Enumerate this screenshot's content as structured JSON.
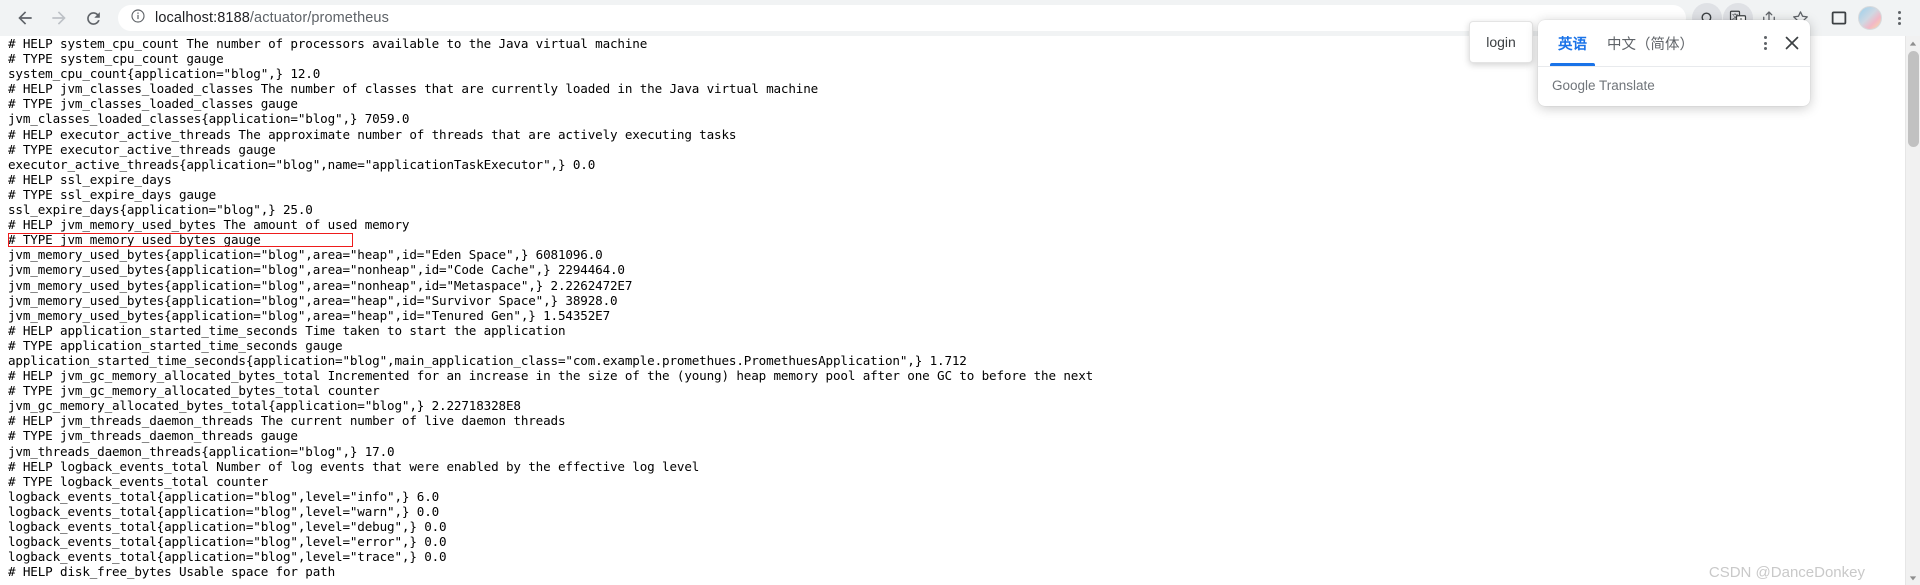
{
  "browser": {
    "back_label": "Back",
    "forward_label": "Forward",
    "reload_label": "Reload",
    "url_host": "localhost:8188",
    "url_path": "/actuator/prometheus",
    "url_full": "localhost:8188/actuator/prometheus",
    "icons": {
      "info": "info-icon",
      "search": "search-icon",
      "translate": "translate-icon",
      "share": "share-icon",
      "bookmark": "star-icon",
      "sidepanel": "side-panel-icon",
      "profile": "avatar-icon",
      "menu": "more-vertical-icon"
    }
  },
  "tooltip": {
    "login_label": "login"
  },
  "translate_popup": {
    "tabs": [
      {
        "label": "英语",
        "selected": true
      },
      {
        "label": "中文（简体）",
        "selected": false
      }
    ],
    "options_label": "More options",
    "close_label": "×",
    "footer": "Google Translate"
  },
  "watermark": {
    "text": "CSDN @DanceDonkey"
  },
  "highlight": {
    "color": "#ee1b1b",
    "line_index": 13
  },
  "metrics": {
    "lines": [
      "# HELP system_cpu_count The number of processors available to the Java virtual machine",
      "# TYPE system_cpu_count gauge",
      "system_cpu_count{application=\"blog\",} 12.0",
      "# HELP jvm_classes_loaded_classes The number of classes that are currently loaded in the Java virtual machine",
      "# TYPE jvm_classes_loaded_classes gauge",
      "jvm_classes_loaded_classes{application=\"blog\",} 7059.0",
      "# HELP executor_active_threads The approximate number of threads that are actively executing tasks",
      "# TYPE executor_active_threads gauge",
      "executor_active_threads{application=\"blog\",name=\"applicationTaskExecutor\",} 0.0",
      "# HELP ssl_expire_days",
      "# TYPE ssl_expire_days gauge",
      "ssl_expire_days{application=\"blog\",} 25.0",
      "# HELP jvm_memory_used_bytes The amount of used memory",
      "# TYPE jvm_memory_used_bytes gauge",
      "jvm_memory_used_bytes{application=\"blog\",area=\"heap\",id=\"Eden Space\",} 6081096.0",
      "jvm_memory_used_bytes{application=\"blog\",area=\"nonheap\",id=\"Code Cache\",} 2294464.0",
      "jvm_memory_used_bytes{application=\"blog\",area=\"nonheap\",id=\"Metaspace\",} 2.2262472E7",
      "jvm_memory_used_bytes{application=\"blog\",area=\"heap\",id=\"Survivor Space\",} 38928.0",
      "jvm_memory_used_bytes{application=\"blog\",area=\"heap\",id=\"Tenured Gen\",} 1.54352E7",
      "# HELP application_started_time_seconds Time taken to start the application",
      "# TYPE application_started_time_seconds gauge",
      "application_started_time_seconds{application=\"blog\",main_application_class=\"com.example.promethues.PromethuesApplication\",} 1.712",
      "# HELP jvm_gc_memory_allocated_bytes_total Incremented for an increase in the size of the (young) heap memory pool after one GC to before the next",
      "# TYPE jvm_gc_memory_allocated_bytes_total counter",
      "jvm_gc_memory_allocated_bytes_total{application=\"blog\",} 2.22718328E8",
      "# HELP jvm_threads_daemon_threads The current number of live daemon threads",
      "# TYPE jvm_threads_daemon_threads gauge",
      "jvm_threads_daemon_threads{application=\"blog\",} 17.0",
      "# HELP logback_events_total Number of log events that were enabled by the effective log level",
      "# TYPE logback_events_total counter",
      "logback_events_total{application=\"blog\",level=\"info\",} 6.0",
      "logback_events_total{application=\"blog\",level=\"warn\",} 0.0",
      "logback_events_total{application=\"blog\",level=\"debug\",} 0.0",
      "logback_events_total{application=\"blog\",level=\"error\",} 0.0",
      "logback_events_total{application=\"blog\",level=\"trace\",} 0.0",
      "# HELP disk_free_bytes Usable space for path"
    ]
  }
}
